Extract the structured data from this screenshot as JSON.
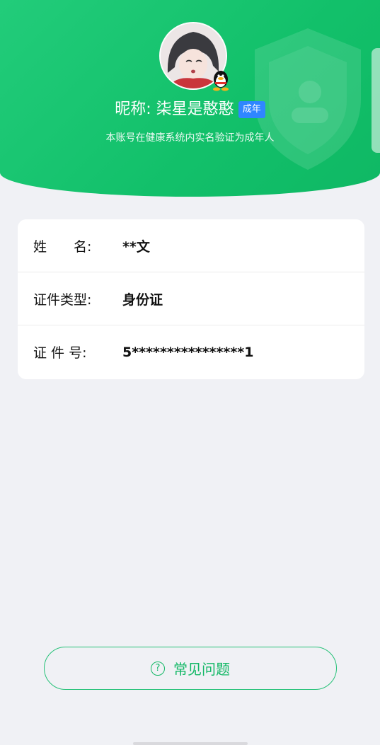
{
  "header": {
    "nickname_label": "昵称: 柒星是憨憨",
    "age_badge": "成年",
    "subtitle": "本账号在健康系统内实名验证为成年人"
  },
  "identity": {
    "rows": [
      {
        "label": "姓　　名:",
        "value": "**文"
      },
      {
        "label": "证件类型:",
        "value": "身份证"
      },
      {
        "label": "证 件 号:",
        "value": "5****************1"
      }
    ]
  },
  "faq": {
    "icon": "?",
    "label": "常见问题"
  },
  "colors": {
    "brand_green": "#13b866",
    "badge_blue": "#2f86ff"
  }
}
